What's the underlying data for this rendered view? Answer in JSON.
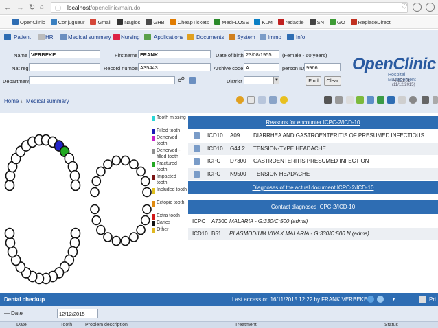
{
  "browser": {
    "url_host": "localhost",
    "url_path": "/openclinic/main.do",
    "bookmarks": [
      "OpenClinic",
      "Conjugueur",
      "Gmail",
      "Nagios",
      "GHB",
      "CheapTickets",
      "MedFLOSS",
      "KLM",
      "redactie",
      "SN",
      "GO",
      "ReplaceDirect"
    ],
    "bookmark_colors": [
      "#2e6db3",
      "#3a80c0",
      "#d44638",
      "#333333",
      "#4a4a4a",
      "#e07b00",
      "#2a8a2a",
      "#0a7fc4",
      "#c02020",
      "#444444",
      "#3d9b35",
      "#c03020"
    ]
  },
  "menu": [
    {
      "label": "Patient",
      "icon": "patient-icon"
    },
    {
      "label": "HR",
      "icon": "hr-icon"
    },
    {
      "label": "Medical summary",
      "icon": "medical-summary-icon"
    },
    {
      "label": "Nursing",
      "icon": "nursing-icon"
    },
    {
      "label": "Applications",
      "icon": "applications-icon"
    },
    {
      "label": "Documents",
      "icon": "documents-icon"
    },
    {
      "label": "System",
      "icon": "system-icon"
    },
    {
      "label": "Immo",
      "icon": "immo-icon"
    },
    {
      "label": "Info",
      "icon": "info-icon"
    }
  ],
  "patient": {
    "name_label": "Name",
    "name": "VERBEKE",
    "firstname_label": "Firstname",
    "firstname": "FRANK",
    "dob_label": "Date of birth",
    "dob": "23/08/1955",
    "dob_extra": "(Female - 60 years)",
    "natreg_label": "Nat reg",
    "natreg": "",
    "recordnumber_label": "Record number",
    "recordnumber": "A35443",
    "archivecode_label": "Archive code",
    "archivecode": "A",
    "personid_label": "person ID",
    "personid": "9966",
    "department_label": "Department",
    "department": "",
    "district_label": "District",
    "district": "",
    "find_button": "Find",
    "clear_button": "Clear"
  },
  "logo": {
    "title": "OpenClinic",
    "subtitle": "Hospital Management",
    "version": "v4.151.01 (11/12/2015)"
  },
  "breadcrumb": {
    "home": "Home",
    "separator": "\\",
    "current": "Medical summary"
  },
  "legend": [
    {
      "label": "Tooth missing",
      "color": "#29d6d6"
    },
    {
      "label": "Filled tooth",
      "color": "#1a1ab8"
    },
    {
      "label": "Denerved tooth",
      "color": "#c81ec8"
    },
    {
      "label": "Denerved - filled tooth",
      "color": "#909090"
    },
    {
      "label": "Fractured tooth",
      "color": "#22a822"
    },
    {
      "label": "Impacted tooth",
      "color": "#7a1414"
    },
    {
      "label": "Included tooth",
      "color": "#e0c020"
    },
    {
      "label": "Ectopic tooth",
      "color": "#e08a10"
    },
    {
      "label": "Extra tooth",
      "color": "#d01818"
    },
    {
      "label": "Caries",
      "color": "#111111"
    },
    {
      "label": "Other",
      "color": "#e0b820"
    }
  ],
  "encounter": {
    "title": "Reasons for encounter ICPC-2/ICD-10",
    "rows": [
      {
        "system": "ICD10",
        "code": "A09",
        "text": "DIARRHEA AND GASTROENTERITIS OF PRESUMED INFECTIOUS ORIGIN"
      },
      {
        "system": "ICD10",
        "code": "G44.2",
        "text": "TENSION-TYPE HEADACHE"
      },
      {
        "system": "ICPC",
        "code": "D7300",
        "text": "GASTROENTERITIS PRESUMED INFECTION"
      },
      {
        "system": "ICPC",
        "code": "N9500",
        "text": "TENSION HEADACHE"
      }
    ]
  },
  "actual_document_title": "Diagnoses of the actual document ICPC-2/ICD-10",
  "contact": {
    "title": "Contact diagnoses ICPC-2/ICD-10",
    "rows": [
      {
        "system": "ICPC",
        "code": "A7300",
        "text": "MALARIA - G:330/C:500 (adms)"
      },
      {
        "system": "ICD10",
        "code": "B51",
        "text": "PLASMODIUM VIVAX MALARIA - G:330/C:500 N (adms)"
      }
    ]
  },
  "dental": {
    "title": "Dental checkup",
    "last_access": "Last access on 16/11/2015 12:22 by FRANK VERBEKE |",
    "print_label": "Pri",
    "date_label": "Date",
    "date_value": "12/12/2015",
    "columns": [
      "Date",
      "Tooth",
      "Problem description",
      "Treatment",
      "Status"
    ]
  }
}
